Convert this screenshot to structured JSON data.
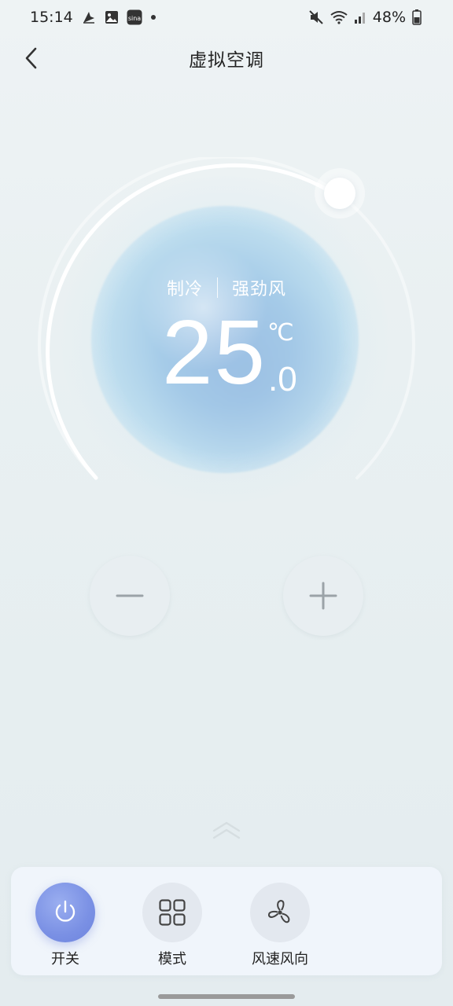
{
  "status_bar": {
    "time": "15:14",
    "battery_percent": "48%",
    "left_icons": [
      "notification-icon",
      "gallery-icon",
      "sina-icon",
      "dot-icon"
    ],
    "right_icons": [
      "mute-icon",
      "wifi-icon",
      "signal-icon",
      "battery-icon"
    ]
  },
  "header": {
    "title": "虚拟空调"
  },
  "dial": {
    "mode": "制冷",
    "fan": "强劲风",
    "temp_integer": "25",
    "temp_decimal": ".0",
    "unit": "℃",
    "colors": {
      "orb": "#a7cde9",
      "knob": "#ffffff",
      "track": "#ffffff"
    }
  },
  "controls": {
    "power_label": "开关",
    "mode_label": "模式",
    "fan_direction_label": "风速风向",
    "accent_color": "#7a90e4"
  }
}
